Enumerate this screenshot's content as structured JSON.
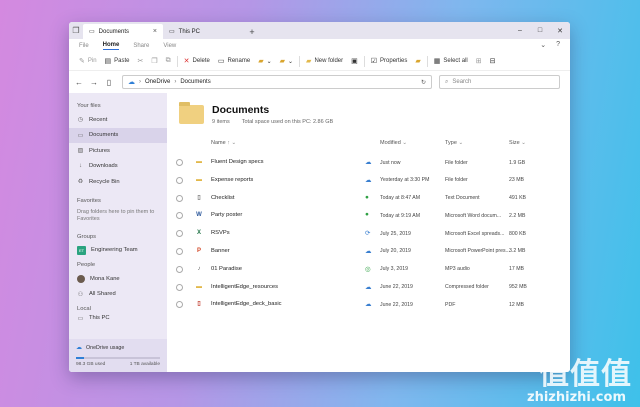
{
  "tabs": [
    {
      "label": "Documents",
      "active": true
    },
    {
      "label": "This PC",
      "active": false
    }
  ],
  "menu_tabs": [
    "File",
    "Home",
    "Share",
    "View"
  ],
  "toolbar": {
    "pin": "Pin",
    "paste": "Paste",
    "delete": "Delete",
    "rename": "Rename",
    "new_folder": "New folder",
    "properties": "Properties",
    "select_all": "Select all"
  },
  "address": {
    "crumbs": [
      "OneDrive",
      "Documents"
    ],
    "search_placeholder": "Search"
  },
  "sidebar": {
    "your_files": "Your files",
    "items": [
      {
        "label": "Recent",
        "icon": "clock-icon"
      },
      {
        "label": "Documents",
        "icon": "document-icon"
      },
      {
        "label": "Pictures",
        "icon": "image-icon"
      },
      {
        "label": "Downloads",
        "icon": "download-icon"
      },
      {
        "label": "Recycle Bin",
        "icon": "recycle-icon"
      }
    ],
    "favorites": "Favorites",
    "favorites_note": "Drag folders here to pin them to Favorites",
    "groups": "Groups",
    "group_badge": "ET",
    "group_item": "Engineering Team",
    "people": "People",
    "person": "Mona Kane",
    "all_shared": "All Shared",
    "local": "Local",
    "local_item": "This PC",
    "usage_title": "OneDrive usage",
    "usage_used": "98.3 GB used",
    "usage_available": "1 TB available",
    "usage_fraction": 0.098
  },
  "main": {
    "title": "Documents",
    "item_count": "9 items",
    "space_used": "Total space used on this PC: 2.86 GB",
    "columns": {
      "name": "Name",
      "modified": "Modified",
      "type": "Type",
      "size": "Size"
    },
    "files": [
      {
        "name": "Fluent Design specs",
        "status": "cloud",
        "modified": "Just now",
        "type": "File folder",
        "size": "1.9 GB",
        "icon": "folder-icon"
      },
      {
        "name": "Expense reports",
        "status": "cloud",
        "modified": "Yesterday at 3:30 PM",
        "type": "File folder",
        "size": "23 MB",
        "icon": "folder-icon"
      },
      {
        "name": "Checklist",
        "status": "ok-solid",
        "modified": "Today at 8:47 AM",
        "type": "Text Document",
        "size": "491 KB",
        "icon": "text-file-icon"
      },
      {
        "name": "Party poster",
        "status": "ok-solid",
        "modified": "Today at 9:19 AM",
        "type": "Microsoft Word docum...",
        "size": "2.2 MB",
        "icon": "word-file-icon"
      },
      {
        "name": "RSVPs",
        "status": "sync",
        "modified": "July 25, 2019",
        "type": "Microsoft Excel spreads...",
        "size": "800 KB",
        "icon": "excel-file-icon"
      },
      {
        "name": "Banner",
        "status": "cloud",
        "modified": "July 20, 2019",
        "type": "Microsoft PowerPoint pres...",
        "size": "3.2 MB",
        "icon": "powerpoint-file-icon"
      },
      {
        "name": "01 Paradise",
        "status": "ok-outline",
        "modified": "July 3, 2019",
        "type": "MP3 audio",
        "size": "17 MB",
        "icon": "audio-file-icon"
      },
      {
        "name": "IntelligentEdge_resources",
        "status": "cloud",
        "modified": "June 22, 2019",
        "type": "Compressed folder",
        "size": "952 MB",
        "icon": "zip-folder-icon"
      },
      {
        "name": "IntelligentEdge_deck_basic",
        "status": "cloud",
        "modified": "June 22, 2019",
        "type": "PDF",
        "size": "12 MB",
        "icon": "pdf-file-icon"
      }
    ]
  },
  "watermark": {
    "logo": "值值值",
    "site": "zhizhizhi.com"
  }
}
